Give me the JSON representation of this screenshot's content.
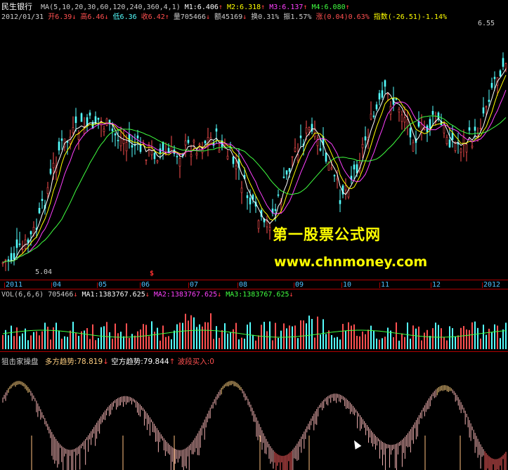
{
  "header": {
    "stock_name": "民生银行",
    "ma_label": "MA(5,10,20,30,60,120,240,360,4,1)",
    "m1": "M1:6.406",
    "m2": "M2:6.318",
    "m3": "M3:6.137",
    "m4": "M4:6.080",
    "date": "2012/01/31",
    "open": "开6.39",
    "high": "高6.46",
    "low": "低6.36",
    "close": "收6.42",
    "volume": "量705466",
    "amount": "额45169",
    "turnover": "换0.31%",
    "amplitude": "振1.57%",
    "change": "涨(0.04)0.63%",
    "index": "指数(-26.51)-1.14%"
  },
  "price_panel": {
    "max_label": "6.55",
    "min_label": "5.04",
    "marker": "$",
    "months": [
      "2011",
      "04",
      "05",
      "06",
      "07",
      "08",
      "09",
      "10",
      "11",
      "12",
      "2012"
    ]
  },
  "volume_panel": {
    "label": "VOL(6,6,6)",
    "value": "705466",
    "ma1": "MA1:1383767.625",
    "ma2": "MA2:1383767.625",
    "ma3": "MA3:1383767.625"
  },
  "indicator_panel": {
    "name": "狙击家操盘",
    "bull": "多方趋势:78.819",
    "bear": "空方趋势:79.844",
    "band": "波段买入:0"
  },
  "watermark": {
    "line1": "第一股票公式网",
    "line2": "www.chnmoney.com"
  },
  "colors": {
    "up": "#ff5050",
    "down": "#54ffff",
    "ma_white": "#ffffff",
    "ma_yellow": "#ffff00",
    "ma_magenta": "#ff40ff",
    "ma_green": "#40ff40",
    "grid": "#b00000",
    "watermark": "#ffff00"
  }
}
